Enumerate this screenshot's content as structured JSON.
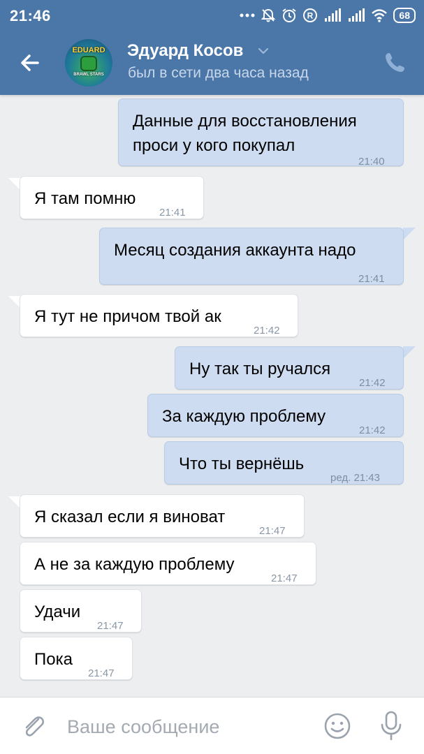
{
  "status_bar": {
    "time": "21:46",
    "battery": "68",
    "icons": [
      "dots-icon",
      "dnd-bell-icon",
      "alarm-icon",
      "registered-icon",
      "signal-icon",
      "signal-icon",
      "wifi-icon",
      "battery-icon"
    ]
  },
  "header": {
    "contact_name": "Эдуард Косов",
    "status": "был в сети два часа назад",
    "avatar_top_text": "EDUARD",
    "avatar_bottom_text": "BRAWL STARS"
  },
  "messages": [
    {
      "direction": "out",
      "text_lines": [
        "Данные для восстановления",
        "проси у кого покупал"
      ],
      "time": "21:40"
    },
    {
      "direction": "in",
      "text_lines": [
        "Я там помню"
      ],
      "time": "21:41"
    },
    {
      "direction": "out",
      "text_lines": [
        "Месяц создания аккаунта надо"
      ],
      "time": "21:41"
    },
    {
      "direction": "in",
      "text_lines": [
        "Я тут не причом твой ак"
      ],
      "time": "21:42"
    },
    {
      "direction": "out",
      "text_lines": [
        "Ну так ты ручался"
      ],
      "time": "21:42"
    },
    {
      "direction": "out",
      "text_lines": [
        "За каждую проблему"
      ],
      "time": "21:42"
    },
    {
      "direction": "out",
      "text_lines": [
        "Что ты вернёшь"
      ],
      "time": "ред. 21:43"
    },
    {
      "direction": "in",
      "text_lines": [
        "Я сказал если я виноват"
      ],
      "time": "21:47"
    },
    {
      "direction": "in",
      "text_lines": [
        "А не за каждую проблему"
      ],
      "time": "21:47"
    },
    {
      "direction": "in",
      "text_lines": [
        "Удачи"
      ],
      "time": "21:47"
    },
    {
      "direction": "in",
      "text_lines": [
        "Пока"
      ],
      "time": "21:47"
    }
  ],
  "compose": {
    "placeholder": "Ваше сообщение"
  },
  "colors": {
    "header": "#4a76a8",
    "background": "#edeef0",
    "incoming": "#ffffff",
    "outgoing": "#cddcf0",
    "time": "#8a97a6"
  }
}
